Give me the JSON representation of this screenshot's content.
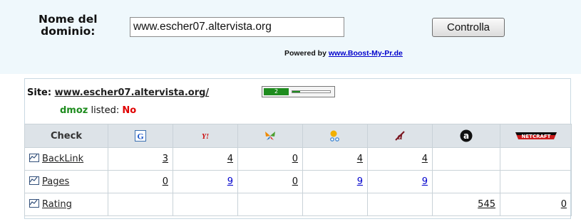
{
  "form": {
    "label_line1": "Nome del",
    "label_line2": "dominio:",
    "domain_value": "www.escher07.altervista.org",
    "button_label": "Controlla",
    "powered_prefix": "Powered by",
    "powered_link": "www.Boost-My-Pr.de"
  },
  "site": {
    "label": "Site:",
    "url": "www.escher07.altervista.org/",
    "pagerank": "2",
    "pagerank_fraction": 0.2,
    "dmoz_label": "dmoz",
    "listed_label": "listed:",
    "listed_value": "No"
  },
  "table": {
    "check_header": "Check",
    "engines": [
      {
        "name": "google-icon"
      },
      {
        "name": "yahoo-icon"
      },
      {
        "name": "msn-butterfly-icon"
      },
      {
        "name": "lycos-dots-icon"
      },
      {
        "name": "altavista-icon"
      },
      {
        "name": "alexa-icon"
      },
      {
        "name": "netcraft-icon",
        "text": "NETCRAFT"
      }
    ],
    "rows": [
      {
        "label": "BackLink",
        "cells": [
          "3",
          "4",
          "0",
          "4",
          "4",
          "",
          ""
        ]
      },
      {
        "label": "Pages",
        "cells": [
          "0",
          "9",
          "0",
          "9",
          "9",
          "",
          ""
        ]
      },
      {
        "label": "Rating",
        "cells": [
          "",
          "",
          "",
          "",
          "",
          "545",
          "0"
        ]
      }
    ]
  },
  "colors": {
    "top_band": "#eff8fc",
    "link_blue": "#0000cc",
    "dmoz_green": "#1e8c1e",
    "no_red": "#e00000",
    "header_gray": "#dde3e8"
  }
}
